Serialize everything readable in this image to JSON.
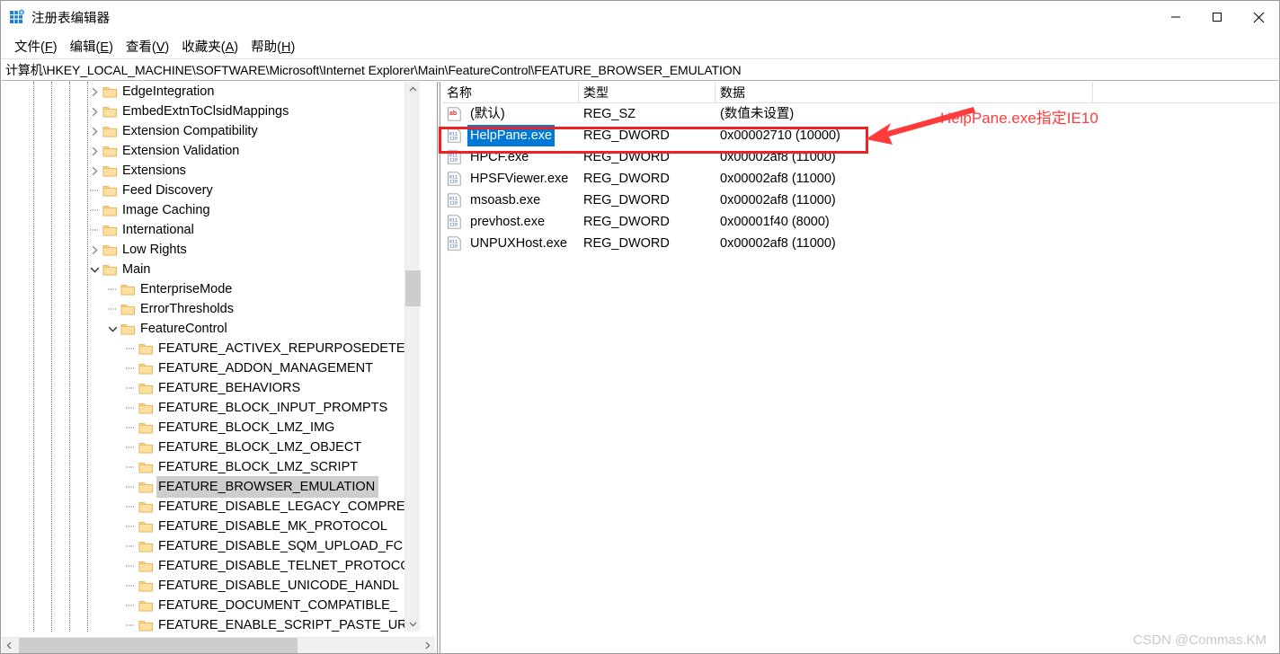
{
  "window": {
    "title": "注册表编辑器",
    "icon": "registry-editor-icon",
    "minimize_label": "最小化",
    "maximize_label": "最大化",
    "close_label": "关闭"
  },
  "menubar": {
    "items": [
      {
        "label": "文件(F)",
        "text": "文件(",
        "accel": "F",
        "tail": ")"
      },
      {
        "label": "编辑(E)",
        "text": "编辑(",
        "accel": "E",
        "tail": ")"
      },
      {
        "label": "查看(V)",
        "text": "查看(",
        "accel": "V",
        "tail": ")"
      },
      {
        "label": "收藏夹(A)",
        "text": "收藏夹(",
        "accel": "A",
        "tail": ")"
      },
      {
        "label": "帮助(H)",
        "text": "帮助(",
        "accel": "H",
        "tail": ")"
      }
    ]
  },
  "address": {
    "path": "计算机\\HKEY_LOCAL_MACHINE\\SOFTWARE\\Microsoft\\Internet Explorer\\Main\\FeatureControl\\FEATURE_BROWSER_EMULATION"
  },
  "tree": {
    "items": [
      {
        "label": "EdgeIntegration",
        "depth": 4,
        "expander": "collapsed",
        "selected": false
      },
      {
        "label": "EmbedExtnToClsidMappings",
        "depth": 4,
        "expander": "collapsed",
        "selected": false
      },
      {
        "label": "Extension Compatibility",
        "depth": 4,
        "expander": "collapsed",
        "selected": false
      },
      {
        "label": "Extension Validation",
        "depth": 4,
        "expander": "collapsed",
        "selected": false
      },
      {
        "label": "Extensions",
        "depth": 4,
        "expander": "collapsed",
        "selected": false
      },
      {
        "label": "Feed Discovery",
        "depth": 4,
        "expander": "none",
        "selected": false
      },
      {
        "label": "Image Caching",
        "depth": 4,
        "expander": "none",
        "selected": false
      },
      {
        "label": "International",
        "depth": 4,
        "expander": "none",
        "selected": false
      },
      {
        "label": "Low Rights",
        "depth": 4,
        "expander": "collapsed",
        "selected": false
      },
      {
        "label": "Main",
        "depth": 4,
        "expander": "expanded",
        "selected": false
      },
      {
        "label": "EnterpriseMode",
        "depth": 5,
        "expander": "none",
        "selected": false
      },
      {
        "label": "ErrorThresholds",
        "depth": 5,
        "expander": "none",
        "selected": false
      },
      {
        "label": "FeatureControl",
        "depth": 5,
        "expander": "expanded",
        "selected": false
      },
      {
        "label": "FEATURE_ACTIVEX_REPURPOSEDETEC",
        "depth": 6,
        "expander": "none",
        "selected": false
      },
      {
        "label": "FEATURE_ADDON_MANAGEMENT",
        "depth": 6,
        "expander": "none",
        "selected": false
      },
      {
        "label": "FEATURE_BEHAVIORS",
        "depth": 6,
        "expander": "none",
        "selected": false
      },
      {
        "label": "FEATURE_BLOCK_INPUT_PROMPTS",
        "depth": 6,
        "expander": "none",
        "selected": false
      },
      {
        "label": "FEATURE_BLOCK_LMZ_IMG",
        "depth": 6,
        "expander": "none",
        "selected": false
      },
      {
        "label": "FEATURE_BLOCK_LMZ_OBJECT",
        "depth": 6,
        "expander": "none",
        "selected": false
      },
      {
        "label": "FEATURE_BLOCK_LMZ_SCRIPT",
        "depth": 6,
        "expander": "none",
        "selected": false
      },
      {
        "label": "FEATURE_BROWSER_EMULATION",
        "depth": 6,
        "expander": "none",
        "selected": true
      },
      {
        "label": "FEATURE_DISABLE_LEGACY_COMPRE",
        "depth": 6,
        "expander": "none",
        "selected": false
      },
      {
        "label": "FEATURE_DISABLE_MK_PROTOCOL",
        "depth": 6,
        "expander": "none",
        "selected": false
      },
      {
        "label": "FEATURE_DISABLE_SQM_UPLOAD_FC",
        "depth": 6,
        "expander": "none",
        "selected": false
      },
      {
        "label": "FEATURE_DISABLE_TELNET_PROTOCO",
        "depth": 6,
        "expander": "none",
        "selected": false
      },
      {
        "label": "FEATURE_DISABLE_UNICODE_HANDL",
        "depth": 6,
        "expander": "none",
        "selected": false
      },
      {
        "label": "FEATURE_DOCUMENT_COMPATIBLE_",
        "depth": 6,
        "expander": "none",
        "selected": false
      },
      {
        "label": "FEATURE_ENABLE_SCRIPT_PASTE_UR",
        "depth": 6,
        "expander": "none",
        "selected": false
      }
    ]
  },
  "list": {
    "columns": [
      {
        "label": "名称"
      },
      {
        "label": "类型"
      },
      {
        "label": "数据"
      }
    ],
    "rows": [
      {
        "name": "(默认)",
        "type": "REG_SZ",
        "data": "(数值未设置)",
        "icon": "string-value-icon",
        "selected": false
      },
      {
        "name": "HelpPane.exe",
        "type": "REG_DWORD",
        "data": "0x00002710 (10000)",
        "icon": "dword-value-icon",
        "selected": true
      },
      {
        "name": "HPCF.exe",
        "type": "REG_DWORD",
        "data": "0x00002af8 (11000)",
        "icon": "dword-value-icon",
        "selected": false
      },
      {
        "name": "HPSFViewer.exe",
        "type": "REG_DWORD",
        "data": "0x00002af8 (11000)",
        "icon": "dword-value-icon",
        "selected": false
      },
      {
        "name": "msoasb.exe",
        "type": "REG_DWORD",
        "data": "0x00002af8 (11000)",
        "icon": "dword-value-icon",
        "selected": false
      },
      {
        "name": "prevhost.exe",
        "type": "REG_DWORD",
        "data": "0x00001f40 (8000)",
        "icon": "dword-value-icon",
        "selected": false
      },
      {
        "name": "UNPUXHost.exe",
        "type": "REG_DWORD",
        "data": "0x00002af8 (11000)",
        "icon": "dword-value-icon",
        "selected": false
      }
    ]
  },
  "annotation": {
    "text": "HelpPane.exe指定IE10",
    "color": "#ff3b3b"
  },
  "watermark": {
    "text": "CSDN @Commas.KM"
  },
  "colors": {
    "selection_blue": "#0078d7",
    "tree_selection_gray": "#cdcdcd",
    "annotation_red": "#ee2222",
    "folder_yellow": "#ffd277"
  }
}
